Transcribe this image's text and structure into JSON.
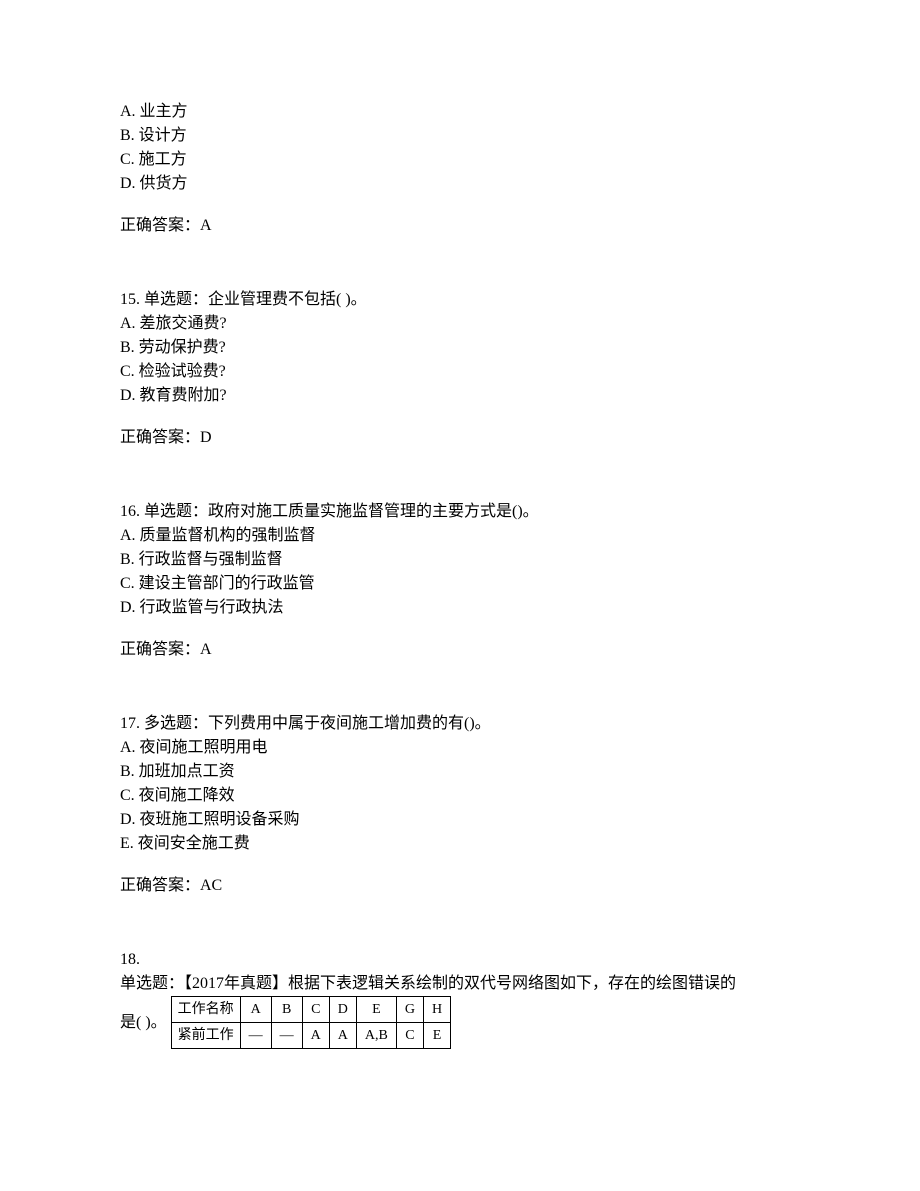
{
  "q14_tail": {
    "options": {
      "A": "A. 业主方",
      "B": "B. 设计方",
      "C": "C. 施工方",
      "D": "D. 供货方"
    },
    "answer": "正确答案：A"
  },
  "q15": {
    "stem": "15.  单选题：企业管理费不包括(   )。",
    "options": {
      "A": "A. 差旅交通费?",
      "B": "B. 劳动保护费?",
      "C": "C. 检验试验费?",
      "D": "D. 教育费附加?"
    },
    "answer": "正确答案：D"
  },
  "q16": {
    "stem": "16.  单选题：政府对施工质量实施监督管理的主要方式是()。",
    "options": {
      "A": "A. 质量监督机构的强制监督",
      "B": "B. 行政监督与强制监督",
      "C": "C. 建设主管部门的行政监管",
      "D": "D. 行政监管与行政执法"
    },
    "answer": "正确答案：A"
  },
  "q17": {
    "stem": "17.  多选题：下列费用中属于夜间施工增加费的有()。",
    "options": {
      "A": "A. 夜间施工照明用电",
      "B": "B. 加班加点工资",
      "C": "C. 夜间施工降效",
      "D": "D. 夜班施工照明设备采购",
      "E": "E. 夜间安全施工费"
    },
    "answer": "正确答案：AC"
  },
  "q18": {
    "number": "18.",
    "stem_line1": "单选题：【2017年真题】根据下表逻辑关系绘制的双代号网络图如下，存在的绘图错误的",
    "stem_line2_prefix": "是(  )。",
    "table": {
      "header_row_label": "工作名称",
      "header_cells": [
        "A",
        "B",
        "C",
        "D",
        "E",
        "G",
        "H"
      ],
      "data_row_label": "紧前工作",
      "data_cells": [
        "—",
        "—",
        "A",
        "A",
        "A,B",
        "C",
        "E"
      ]
    }
  }
}
